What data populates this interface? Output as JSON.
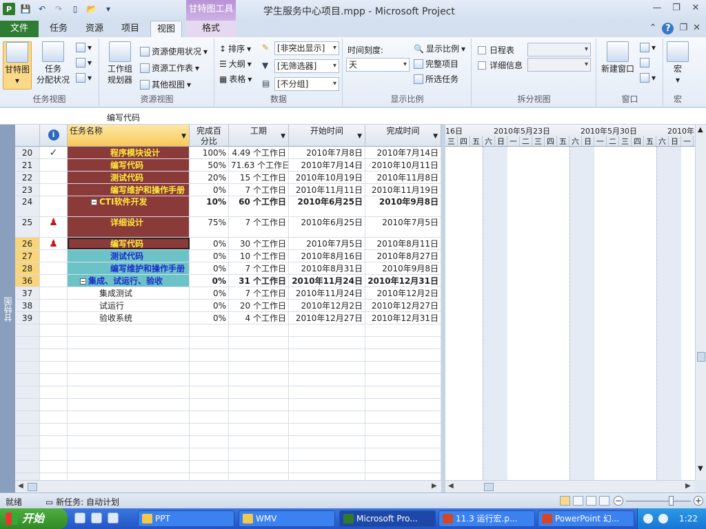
{
  "window": {
    "title": "学生服务中心项目.mpp - Microsoft Project",
    "context_tab_title": "甘特图工具",
    "app_icon": "P"
  },
  "tabs": [
    "文件",
    "任务",
    "资源",
    "项目",
    "视图",
    "格式"
  ],
  "active_tab": "视图",
  "ribbon": {
    "task_view": {
      "gantt_label": "甘特图",
      "assign_label_1": "任务",
      "assign_label_2": "分配状况",
      "group_label": "任务视图"
    },
    "resource_view": {
      "team_planner_1": "工作组",
      "team_planner_2": "规划器",
      "usage": "资源使用状况",
      "sheet": "资源工作表",
      "other": "其他视图",
      "group_label": "资源视图"
    },
    "data": {
      "sort": "排序",
      "outline": "大纲",
      "tables": "表格",
      "highlight": "[非突出显示]",
      "filter": "[无筛选器]",
      "group": "[不分组]",
      "group_label": "数据"
    },
    "zoom": {
      "timescale_label": "时间刻度:",
      "timescale_value": "天",
      "zoom": "显示比例",
      "entire_project": "完整项目",
      "selected_tasks": "所选任务",
      "group_label": "显示比例"
    },
    "split": {
      "timeline": "日程表",
      "details": "详细信息",
      "group_label": "拆分视图"
    },
    "window": {
      "new_window": "新建窗口",
      "group_label": "窗口"
    },
    "macros": {
      "macros": "宏",
      "group_label": "宏"
    }
  },
  "entry_bar": {
    "value": "编写代码"
  },
  "view_bar": {
    "label": "甘特图"
  },
  "table": {
    "headers": {
      "name": "任务名称",
      "pct_1": "完成百",
      "pct_2": "分比",
      "duration": "工期",
      "start": "开始时间",
      "finish": "完成时间"
    },
    "rows": [
      {
        "id": "20",
        "ind": "✓",
        "name": "程序模块设计",
        "pct": "100%",
        "dur": "4.49 个工作日",
        "start": "2010年7月8日",
        "end": "2010年7月14日"
      },
      {
        "id": "21",
        "ind": "",
        "name": "编写代码",
        "pct": "50%",
        "dur": "71.63 个工作日",
        "start": "2010年7月14日",
        "end": "2010年10月11日"
      },
      {
        "id": "22",
        "ind": "",
        "name": "测试代码",
        "pct": "20%",
        "dur": "15 个工作日",
        "start": "2010年10月19日",
        "end": "2010年11月8日"
      },
      {
        "id": "23",
        "ind": "",
        "name": "编写维护和操作手册",
        "pct": "0%",
        "dur": "7 个工作日",
        "start": "2010年11月11日",
        "end": "2010年11月19日"
      },
      {
        "id": "24",
        "ind": "",
        "name": "CTI软件开发",
        "pct": "10%",
        "dur": "60 个工作日",
        "start": "2010年6月25日",
        "end": "2010年9月8日"
      },
      {
        "id": "25",
        "ind": "♟",
        "name": "详细设计",
        "pct": "75%",
        "dur": "7 个工作日",
        "start": "2010年6月25日",
        "end": "2010年7月5日"
      },
      {
        "id": "26",
        "ind": "♟",
        "name": "编写代码",
        "pct": "0%",
        "dur": "30 个工作日",
        "start": "2010年7月5日",
        "end": "2010年8月11日"
      },
      {
        "id": "27",
        "ind": "",
        "name": "测试代码",
        "pct": "0%",
        "dur": "10 个工作日",
        "start": "2010年8月16日",
        "end": "2010年8月27日"
      },
      {
        "id": "28",
        "ind": "",
        "name": "编写维护和操作手册",
        "pct": "0%",
        "dur": "7 个工作日",
        "start": "2010年8月31日",
        "end": "2010年9月8日"
      },
      {
        "id": "36",
        "ind": "",
        "name": "集成、试运行、验收",
        "pct": "0%",
        "dur": "31 个工作日",
        "start": "2010年11月24日",
        "end": "2010年12月31日"
      },
      {
        "id": "37",
        "ind": "",
        "name": "集成测试",
        "pct": "0%",
        "dur": "7 个工作日",
        "start": "2010年11月24日",
        "end": "2010年12月2日"
      },
      {
        "id": "38",
        "ind": "",
        "name": "试运行",
        "pct": "0%",
        "dur": "20 个工作日",
        "start": "2010年12月2日",
        "end": "2010年12月27日"
      },
      {
        "id": "39",
        "ind": "",
        "name": "验收系统",
        "pct": "0%",
        "dur": "4 个工作日",
        "start": "2010年12月27日",
        "end": "2010年12月31日"
      }
    ]
  },
  "gantt": {
    "weeks": [
      "16日",
      "2010年5月23日",
      "2010年5月30日",
      "2010年"
    ],
    "days": [
      "三",
      "四",
      "五",
      "六",
      "日",
      "一",
      "二",
      "三",
      "四",
      "五",
      "六",
      "日",
      "一",
      "二",
      "三",
      "四",
      "五",
      "六",
      "日",
      "一"
    ]
  },
  "status": {
    "ready": "就绪",
    "new_tasks": "新任务: 自动计划"
  },
  "taskbar": {
    "start": "开始",
    "items": [
      "PPT",
      "WMV",
      "Microsoft Pro...",
      "11.3 运行宏.p...",
      "PowerPoint 幻..."
    ],
    "clock": "1:22"
  },
  "colors": {
    "summary_red": "#8b3a3a",
    "text_yellow": "#ffeb3b",
    "teal": "#6cc3c7",
    "text_blue": "#1a2ccc",
    "file_tab": "#2e7d32"
  }
}
